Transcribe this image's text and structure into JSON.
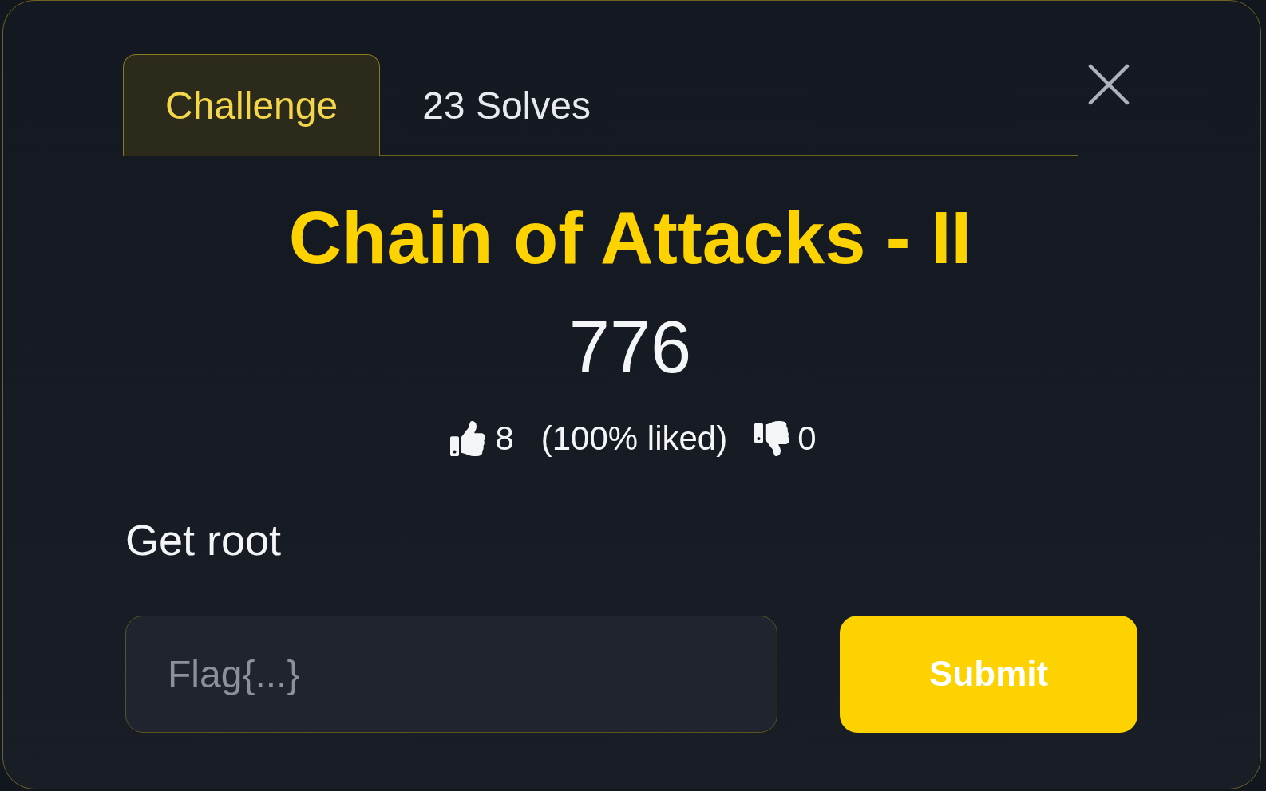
{
  "tabs": [
    {
      "label": "Challenge",
      "selected": true
    },
    {
      "label": "23 Solves",
      "selected": false
    }
  ],
  "challenge": {
    "title": "Chain of Attacks - II",
    "points": "776",
    "likes": "8",
    "liked_share": "(100% liked)",
    "dislikes": "0",
    "description": "Get root"
  },
  "flag_form": {
    "placeholder": "Flag{...}",
    "submit": "Submit"
  }
}
